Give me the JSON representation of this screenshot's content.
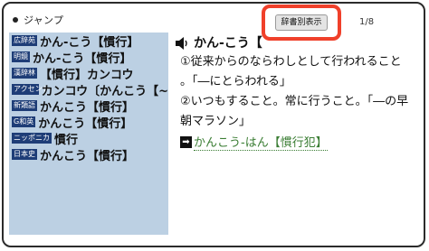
{
  "header": {
    "title": "ジャンプ"
  },
  "toolbar": {
    "dict_view_label": "辞書別表示",
    "page_indicator": "1/8"
  },
  "entries": [
    {
      "tag": "広辞苑",
      "text": "かん‐こう【慣行】"
    },
    {
      "tag": "明鏡",
      "text": "かん‐こう【慣行】"
    },
    {
      "tag": "漢辞林",
      "text": "【慣行】カンコウ"
    },
    {
      "tag": "アクセント",
      "text": "カンコウ〔かんこう【~"
    },
    {
      "tag": "新類語",
      "text": "かんこう【慣行】"
    },
    {
      "tag": "G和英",
      "text": "かんこう【慣行】"
    },
    {
      "tag": "ニッポニカ",
      "text": "慣行"
    },
    {
      "tag": "日本史",
      "text": "かんこう【慣行】"
    }
  ],
  "detail": {
    "headword": "かん‐こう【",
    "def1_line1": "①従来からのならわしとして行われること",
    "def1_line2": "。「―にとらわれる」",
    "def2_line1": "②いつもすること。常に行うこと。「―の早",
    "def2_line2": "朝マラソン」",
    "link_text": "かんこう‐はん【慣行犯】"
  },
  "colors": {
    "tag_bg": "#1e3d77",
    "list_bg": "#bcd0e3",
    "highlight_border": "#f0402a",
    "link": "#3a7d33"
  }
}
